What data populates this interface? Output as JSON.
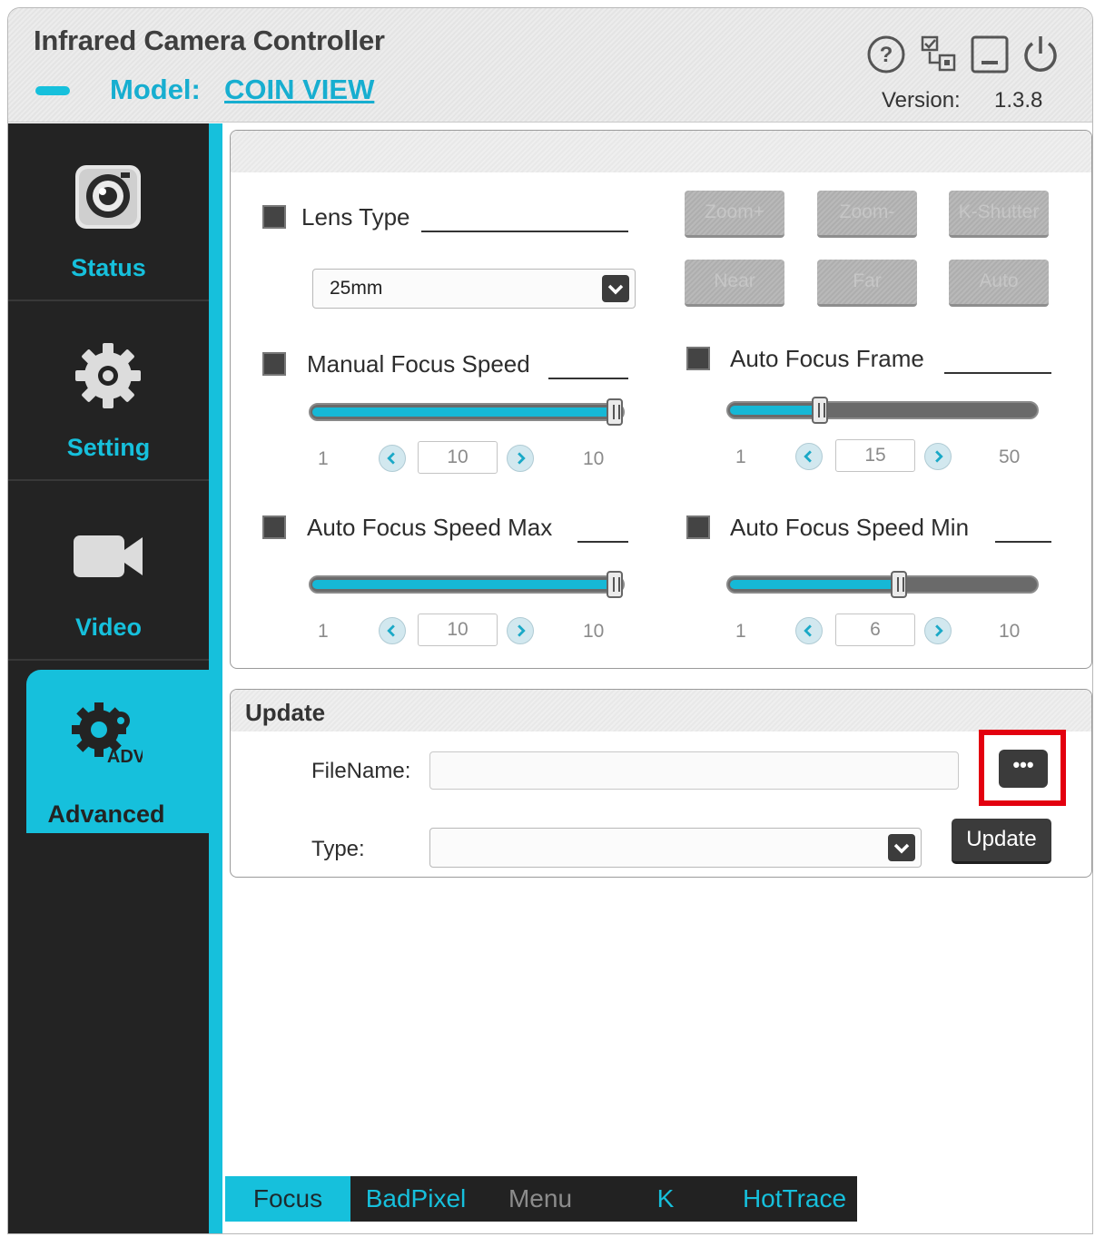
{
  "header": {
    "app_title": "Infrared Camera Controller",
    "model_label": "Model:",
    "model_value": "COIN VIEW",
    "version_label": "Version:",
    "version_value": "1.3.8",
    "icons": [
      "help-icon",
      "checklist-icon",
      "minimize-icon",
      "power-icon"
    ]
  },
  "sidebar": {
    "items": [
      {
        "label": "Status",
        "icon": "camera-icon"
      },
      {
        "label": "Setting",
        "icon": "gear-icon"
      },
      {
        "label": "Video",
        "icon": "video-camera-icon"
      },
      {
        "label": "Advanced",
        "icon": "adv-gears-icon",
        "icon_text": "ADV",
        "active": true
      }
    ]
  },
  "focus": {
    "lens_type_label": "Lens Type",
    "lens_type_value": "25mm",
    "buttons": [
      "Zoom+",
      "Zoom-",
      "K-Shutter",
      "Near",
      "Far",
      "Auto"
    ],
    "manual_focus_speed": {
      "label": "Manual Focus Speed",
      "min": "1",
      "max": "10",
      "value": "10",
      "fraction": 1.0
    },
    "auto_focus_frame": {
      "label": "Auto Focus Frame",
      "min": "1",
      "max": "50",
      "value": "15",
      "fraction": 0.286
    },
    "auto_focus_speed_max": {
      "label": "Auto Focus Speed Max",
      "min": "1",
      "max": "10",
      "value": "10",
      "fraction": 1.0
    },
    "auto_focus_speed_min": {
      "label": "Auto Focus Speed Min",
      "min": "1",
      "max": "10",
      "value": "6",
      "fraction": 0.556
    }
  },
  "update": {
    "title": "Update",
    "filename_label": "FileName:",
    "filename_value": "",
    "browse_label": "•••",
    "type_label": "Type:",
    "type_value": "",
    "update_button": "Update"
  },
  "tabs": [
    {
      "label": "Focus",
      "active": true,
      "color": "#1d2b2f"
    },
    {
      "label": "BadPixel",
      "color": "#16c0dc"
    },
    {
      "label": "Menu",
      "color": "#8c8c8c"
    },
    {
      "label": "K",
      "color": "#16c0dc"
    },
    {
      "label": "HotTrace",
      "color": "#16c0dc"
    }
  ],
  "colors": {
    "accent": "#16c0dc",
    "sidebar_bg": "#232323",
    "highlight": "#e3000f"
  }
}
